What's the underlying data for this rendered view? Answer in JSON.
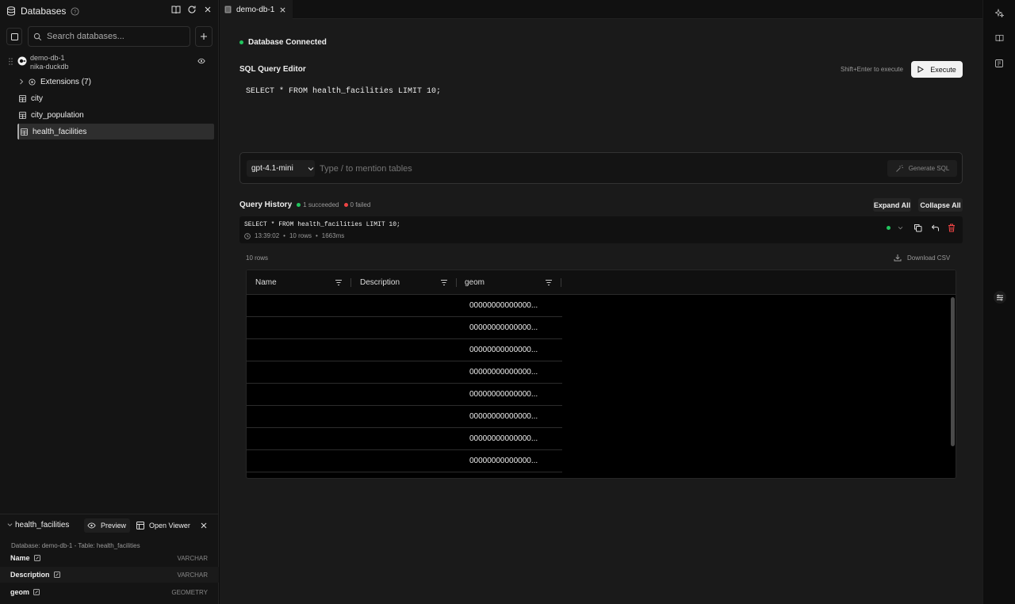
{
  "sidebar": {
    "title": "Databases",
    "search_placeholder": "Search databases...",
    "database": {
      "name": "demo-db-1",
      "engine": "nika-duckdb"
    },
    "tree": {
      "extensions_label": "Extensions (7)",
      "tables": [
        "city",
        "city_population",
        "health_facilities"
      ],
      "selected": "health_facilities"
    }
  },
  "table_panel": {
    "name": "health_facilities",
    "preview_label": "Preview",
    "open_viewer_label": "Open Viewer",
    "breadcrumb": "Database: demo-db-1 - Table: health_facilities",
    "columns": [
      {
        "name": "Name",
        "type": "VARCHAR"
      },
      {
        "name": "Description",
        "type": "VARCHAR"
      },
      {
        "name": "geom",
        "type": "GEOMETRY"
      }
    ]
  },
  "main": {
    "tab_label": "demo-db-1",
    "status_text": "Database Connected",
    "status_color": "#22c55e",
    "editor": {
      "title": "SQL Query Editor",
      "hint": "Shift+Enter to execute",
      "execute_label": "Execute",
      "query": "SELECT * FROM health_facilities LIMIT 10;"
    },
    "ai": {
      "model": "gpt-4.1-mini",
      "placeholder": "Type / to mention tables",
      "generate_label": "Generate SQL"
    },
    "history": {
      "title": "Query History",
      "succeeded": "1 succeeded",
      "failed": "0 failed",
      "success_color": "#22c55e",
      "fail_color": "#ef4444",
      "expand_all": "Expand All",
      "collapse_all": "Collapse All",
      "entry": {
        "query": "SELECT * FROM health_facilities LIMIT 10;",
        "time": "13:39:02",
        "rows": "10 rows",
        "duration": "1663ms"
      }
    },
    "results": {
      "row_count": "10 rows",
      "download_label": "Download CSV",
      "columns": [
        "Name",
        "Description",
        "geom"
      ],
      "rows": [
        "00000000000000...",
        "00000000000000...",
        "00000000000000...",
        "00000000000000...",
        "00000000000000...",
        "00000000000000...",
        "00000000000000...",
        "00000000000000..."
      ]
    }
  },
  "icons": {
    "rail": [
      "sparkles-icon",
      "book-icon",
      "notebook-icon",
      "settings-panel-icon"
    ]
  }
}
